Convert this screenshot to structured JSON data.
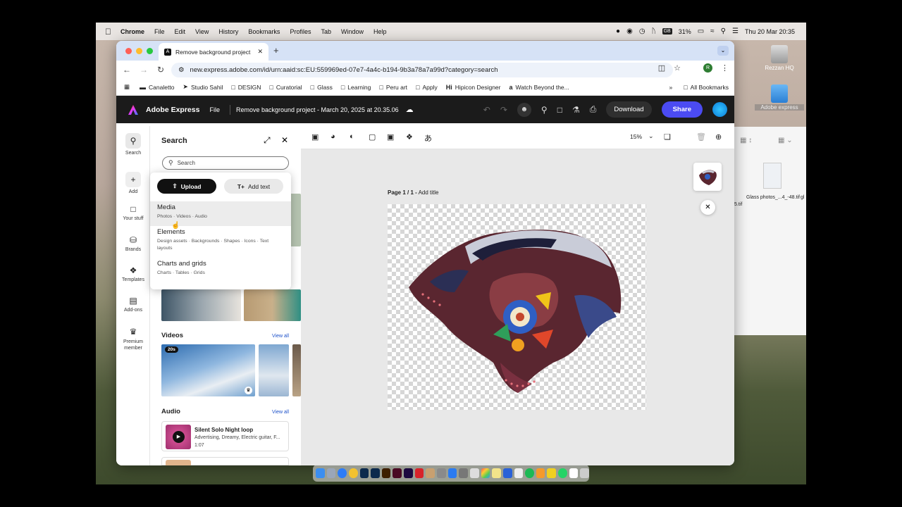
{
  "menubar": {
    "app": "Chrome",
    "items": [
      "File",
      "Edit",
      "View",
      "History",
      "Bookmarks",
      "Profiles",
      "Tab",
      "Window",
      "Help"
    ],
    "battery": "31%",
    "datetime": "Thu 20 Mar  20:35",
    "icons": [
      "record-icon",
      "focus-icon",
      "clock-icon",
      "bluetooth-icon",
      "keyboard-icon",
      "battery-icon",
      "wifi-icon",
      "search-icon",
      "control-center-icon"
    ]
  },
  "desktop": {
    "icons": [
      {
        "label": "Rezzan HQ"
      },
      {
        "label": "Adobe express"
      },
      {
        "label": "Glass photos_...4_-48.tif"
      }
    ],
    "partial_labels": [
      "5.tif",
      "gl"
    ]
  },
  "browser": {
    "tab_title": "Remove background project",
    "url": "new.express.adobe.com/id/urn:aaid:sc:EU:559969ed-07e7-4a4c-b194-9b3a78a7a99d?category=search",
    "profile_initial": "R",
    "bookmarks": [
      {
        "label": "Canaletto",
        "icon": "canaletto-icon"
      },
      {
        "label": "Studio Sahil",
        "icon": "rocket-icon"
      },
      {
        "label": "DESIGN",
        "icon": "folder-icon"
      },
      {
        "label": "Curatorial",
        "icon": "folder-icon"
      },
      {
        "label": "Glass",
        "icon": "folder-icon"
      },
      {
        "label": "Learning",
        "icon": "folder-icon"
      },
      {
        "label": "Peru art",
        "icon": "folder-icon"
      },
      {
        "label": "Apply",
        "icon": "folder-icon"
      },
      {
        "label": "Hipicon Designer",
        "icon": "hi-icon"
      },
      {
        "label": "Watch Beyond the...",
        "icon": "amazon-icon"
      }
    ],
    "all_bookmarks": "All Bookmarks"
  },
  "express": {
    "app_name": "Adobe Express",
    "file_menu": "File",
    "project_title": "Remove background project - March 20, 2025 at 20.35.06",
    "download": "Download",
    "share": "Share",
    "accent": "#4b4bf2"
  },
  "rail": [
    {
      "label": "Search",
      "icon": "search-icon"
    },
    {
      "label": "Add",
      "icon": "plus-icon"
    },
    {
      "label": "Your stuff",
      "icon": "folder-icon"
    },
    {
      "label": "Brands",
      "icon": "brand-icon"
    },
    {
      "label": "Templates",
      "icon": "templates-icon"
    },
    {
      "label": "Add-ons",
      "icon": "addons-icon"
    },
    {
      "label": "Premium member",
      "icon": "crown-icon"
    }
  ],
  "panel": {
    "title": "Search",
    "search_placeholder": "Search",
    "videos_heading": "Videos",
    "audio_heading": "Audio",
    "view_all": "View all",
    "video_badge": "20s",
    "audio_item": {
      "title": "Silent Solo Night loop",
      "tags": "Advertising, Dreamy, Electric guitar, F...",
      "duration": "1:07"
    }
  },
  "dropdown": {
    "upload": "Upload",
    "add_text": "Add text",
    "items": [
      {
        "title": "Media",
        "sub": "Photos · Videos · Audio"
      },
      {
        "title": "Elements",
        "sub": "Design assets · Backgrounds · Shapes · Icons · Text layouts"
      },
      {
        "title": "Charts and grids",
        "sub": "Charts · Tables · Grids"
      }
    ]
  },
  "canvas": {
    "zoom": "15%",
    "page_label_prefix": "Page 1 / 1 -",
    "page_label_action": "Add title"
  }
}
